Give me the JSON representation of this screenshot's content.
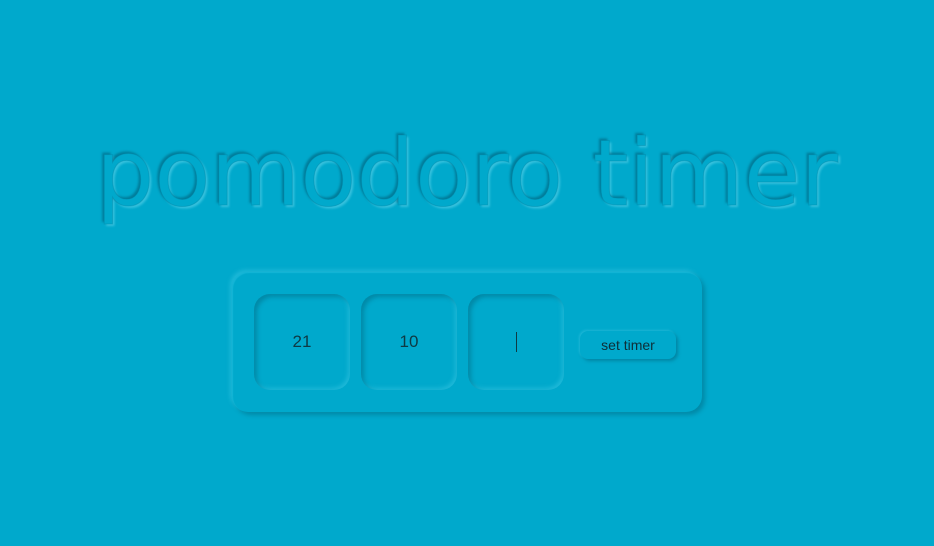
{
  "page": {
    "title": "pomodoro timer",
    "background_color": "#00a9cc"
  },
  "timer_form": {
    "hours_value": "21",
    "minutes_value": "10",
    "seconds_value": "",
    "set_button_label": "set timer"
  }
}
